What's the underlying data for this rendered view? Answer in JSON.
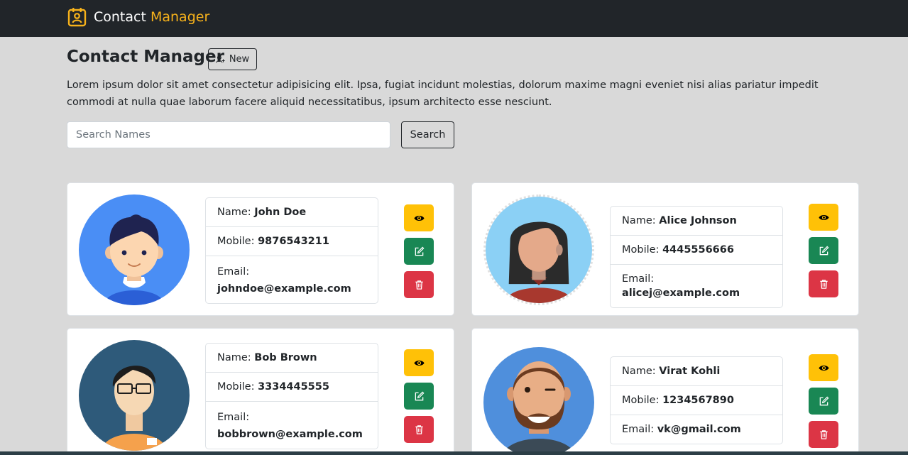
{
  "navbar": {
    "brand_main": "Contact",
    "brand_accent": "Manager",
    "icon": "contact-book-icon"
  },
  "header": {
    "title": "Contact Manager",
    "new_button_label": "New",
    "new_button_icon": "person-plus-icon"
  },
  "description": "Lorem ipsum dolor sit amet consectetur adipisicing elit. Ipsa, fugiat incidunt molestias, dolorum maxime magni eveniet nisi alias pariatur impedit commodi at nulla quae laborum facere aliquid necessitatibus, ipsum architecto esse nesciunt.",
  "search": {
    "placeholder": "Search Names",
    "value": "",
    "button_label": "Search"
  },
  "labels": {
    "name": "Name:",
    "mobile": "Mobile:",
    "email": "Email:"
  },
  "contacts": [
    {
      "name": "John Doe",
      "mobile": "9876543211",
      "email": "johndoe@example.com"
    },
    {
      "name": "Alice Johnson",
      "mobile": "4445556666",
      "email": "alicej@example.com"
    },
    {
      "name": "Bob Brown",
      "mobile": "3334445555",
      "email": "bobbrown@example.com"
    },
    {
      "name": "Virat Kohli",
      "mobile": "1234567890",
      "email": "vk@gmail.com"
    }
  ],
  "action_icons": [
    "eye-icon",
    "pencil-square-icon",
    "trash-icon"
  ],
  "colors": {
    "navbar_bg": "#212529",
    "brand_accent": "#f7b21b",
    "page_bg": "#d9d9d9",
    "view_button": "#ffc107",
    "edit_button": "#198754",
    "delete_button": "#dc3545"
  }
}
